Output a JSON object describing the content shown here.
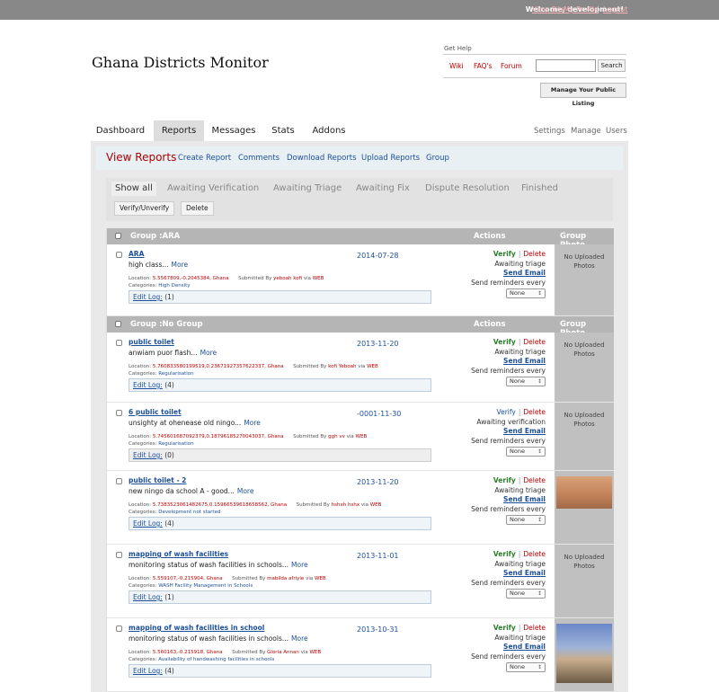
{
  "topbar": {
    "welcome": "Welcome, development!",
    "view_site": "View Site",
    "my_profile": "My Profile",
    "logout": "Logout",
    "sep": "|"
  },
  "site_title": "Ghana Districts Monitor",
  "help": {
    "get_help": "Get Help",
    "wiki": "Wiki",
    "faqs": "FAQ's",
    "forum": "Forum",
    "search_value": "",
    "search_button": "Search",
    "manage_listing": "Manage Your Public Listing"
  },
  "nav": {
    "tabs": [
      "Dashboard",
      "Reports",
      "Messages",
      "Stats",
      "Addons"
    ],
    "active": "Reports",
    "right": [
      "Settings",
      "Manage",
      "Users"
    ]
  },
  "viewbar": {
    "title": "View Reports",
    "links": [
      "Create Report",
      "Comments",
      "Download Reports",
      "Upload Reports",
      "Group"
    ]
  },
  "filters": {
    "tabs": [
      "Show all",
      "Awaiting Verification",
      "Awaiting Triage",
      "Awaiting Fix",
      "Dispute Resolution",
      "Finished"
    ],
    "buttons": [
      "Verify/Unverify",
      "Delete"
    ]
  },
  "groups": [
    {
      "title": "Group :ARA",
      "actions_label": "Actions",
      "photo_label": "Group Photo"
    },
    {
      "title": "Group :No Group",
      "actions_label": "Actions",
      "photo_label": "Group Photo"
    }
  ],
  "labels": {
    "location": "Location:",
    "submitted_by": "Submitted By",
    "via": "via",
    "categories": "Categories:",
    "edit_log": "Edit Log:",
    "more": "More",
    "send_email": "Send Email",
    "send_reminders": "Send reminders every",
    "reminder_option": "None",
    "delete": "Delete",
    "sep": "|",
    "no_photos": "No Uploaded Photos"
  },
  "reports": [
    {
      "title": "ARA",
      "desc": "high class...",
      "date": "2014-07-28",
      "location": "5.5567809,-0.2045384, Ghana",
      "submitter": "yeboah kofi",
      "source": "WEB",
      "category": "High Density",
      "edit_log": "(1)",
      "verify": "Verify",
      "status": "Awaiting triage",
      "photo": "none"
    },
    {
      "title": "public toilet",
      "desc": "anwiam puor flash...",
      "date": "2013-11-20",
      "location": "5.760833580199519,0.23671927357622337, Ghana",
      "submitter": "kofi Yeboah",
      "source": "WEB",
      "category": "Regularisation",
      "edit_log": "(4)",
      "verify": "Verify",
      "status": "Awaiting triage",
      "photo": "none"
    },
    {
      "title": "6 public toilet",
      "desc": "unsighty at ohenease old ningo...",
      "date": "-0001-11-30",
      "location": "5.745601687092379,0.18796185270043037, Ghana",
      "submitter": "ggh vv",
      "source": "WEB",
      "category": "Regularisation",
      "edit_log": "(0)",
      "verify": "Verify",
      "status": "Awaiting verification",
      "photo": "none"
    },
    {
      "title": "public toilet - 2",
      "desc": "new ningo da school A - good...",
      "date": "2013-11-20",
      "location": "5.7383523061482675,0.15966539618658562, Ghana",
      "submitter": "hshxh hshx",
      "source": "WEB",
      "category": "Development not started",
      "edit_log": "(4)",
      "verify": "Verify",
      "status": "Awaiting triage",
      "photo": "wall"
    },
    {
      "title": "mapping of wash facilities",
      "desc": "monitoring status of wash facilities in schools...",
      "date": "2013-11-01",
      "location": "5.559107,-0.215904, Ghana",
      "submitter": "mabilda afriyie",
      "source": "WEB",
      "category": "WASH Facility Management in Schools",
      "edit_log": "(1)",
      "verify": "Verify",
      "status": "Awaiting triage",
      "photo": "none"
    },
    {
      "title": "mapping of wash facilities in school",
      "desc": "monitoring status of wash facilities in schools...",
      "date": "2013-10-31",
      "location": "5.560163,-0.215918, Ghana",
      "submitter": "Gloria Annan",
      "source": "WEB",
      "category": "Availability of handwashing facilities in schools",
      "edit_log": "(4)",
      "verify": "Verify",
      "status": "Awaiting triage",
      "photo": "house"
    }
  ]
}
